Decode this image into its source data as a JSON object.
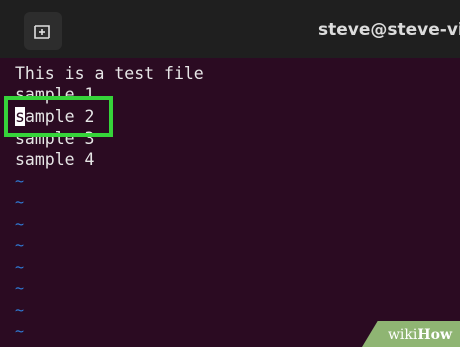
{
  "window": {
    "title": "steve@steve-virt"
  },
  "icons": {
    "new_tab": "new-tab-icon"
  },
  "editor": {
    "lines": [
      "This is a test file",
      "sample 1",
      "sample 2",
      "sample 3",
      "sample 4"
    ],
    "cursor_line_rest": "ample 2",
    "cursor_char": "s",
    "empty_line_marker": "~"
  },
  "watermark": {
    "part1": "wiki",
    "part2": "How"
  },
  "colors": {
    "background": "#2b0b22",
    "tilde": "#2f7bd6",
    "highlight": "#36d43a"
  }
}
